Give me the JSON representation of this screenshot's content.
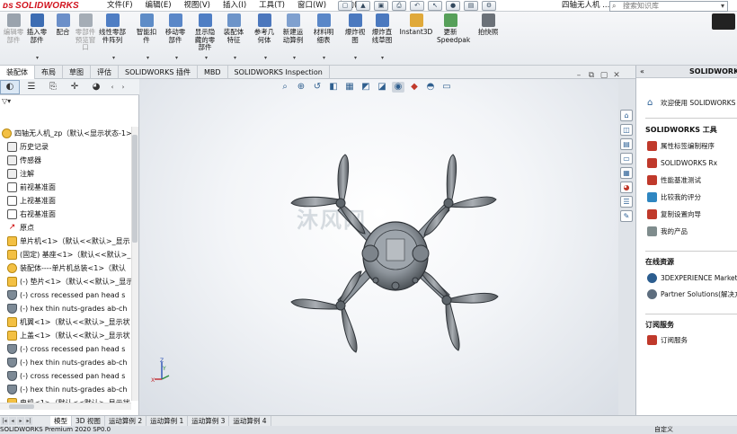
{
  "app": {
    "logo_text": "SOLIDWORKS",
    "doc_title": "四轴无人机 ...",
    "search_placeholder": "搜索知识库",
    "brand_color": "#d1121d"
  },
  "menu": [
    "文件(F)",
    "编辑(E)",
    "视图(V)",
    "插入(I)",
    "工具(T)",
    "窗口(W)",
    "帮助(H)"
  ],
  "ribbon": {
    "buttons": [
      {
        "label": "编辑零\n部件",
        "dim": true,
        "icon": "edit-component-icon"
      },
      {
        "label": "插入零\n部件",
        "dim": false,
        "icon": "insert-component-icon"
      },
      {
        "label": "配合",
        "dim": false,
        "icon": "mate-icon"
      },
      {
        "label": "零部件\n预览窗\n口",
        "dim": true,
        "icon": "preview-window-icon"
      },
      {
        "label": "线性零部\n件阵列",
        "dim": false,
        "icon": "linear-pattern-icon"
      },
      {
        "label": "智能扣\n件",
        "dim": false,
        "icon": "smart-fastener-icon"
      },
      {
        "label": "移动零\n部件",
        "dim": false,
        "icon": "move-component-icon"
      },
      {
        "label": "显示隐\n藏的零\n部件",
        "dim": false,
        "icon": "show-hidden-icon"
      },
      {
        "label": "装配体\n特征",
        "dim": false,
        "icon": "assembly-feature-icon"
      },
      {
        "label": "参考几\n何体",
        "dim": false,
        "icon": "reference-geometry-icon"
      },
      {
        "label": "新建运\n动算例",
        "dim": false,
        "icon": "motion-study-icon"
      },
      {
        "label": "材料明\n细表",
        "dim": false,
        "icon": "bom-icon"
      },
      {
        "label": "爆炸视\n图",
        "dim": false,
        "icon": "explode-view-icon"
      },
      {
        "label": "爆炸直\n线草图",
        "dim": false,
        "icon": "explode-line-sketch-icon"
      },
      {
        "label": "Instant3D",
        "dim": false,
        "icon": "instant3d-icon"
      },
      {
        "label": "更新\nSpeedpak",
        "dim": false,
        "icon": "speedpak-icon"
      },
      {
        "label": "拍快照",
        "dim": false,
        "icon": "snapshot-icon"
      }
    ]
  },
  "tabs": [
    "装配体",
    "布局",
    "草图",
    "评估",
    "SOLIDWORKS 插件",
    "MBD",
    "SOLIDWORKS Inspection"
  ],
  "active_tab": "装配体",
  "tree": {
    "root": "四轴无人机_zp（默认<显示状态-1>）",
    "items": [
      {
        "label": "历史记录",
        "icon": "folder"
      },
      {
        "label": "传感器",
        "icon": "folder"
      },
      {
        "label": "注解",
        "icon": "folder"
      },
      {
        "label": "前视基准面",
        "icon": "plane"
      },
      {
        "label": "上视基准面",
        "icon": "plane"
      },
      {
        "label": "右视基准面",
        "icon": "plane"
      },
      {
        "label": "原点",
        "icon": "origin"
      },
      {
        "label": "单片机<1>（默认<<默认>_显示",
        "icon": "part"
      },
      {
        "label": "(固定) 基座<1>（默认<<默认>_",
        "icon": "part"
      },
      {
        "label": "装配体----单片机总装<1>（默认",
        "icon": "asm"
      },
      {
        "label": "(-) 垫片<1>（默认<<默认>_显示",
        "icon": "part"
      },
      {
        "label": "(-) cross recessed pan head s",
        "icon": "screw"
      },
      {
        "label": "(-) hex thin nuts-grades ab-ch",
        "icon": "screw"
      },
      {
        "label": "机翼<1>（默认<<默认>_显示状",
        "icon": "part"
      },
      {
        "label": "上盖<1>（默认<<默认>_显示状",
        "icon": "part"
      },
      {
        "label": "(-) cross recessed pan head s",
        "icon": "screw"
      },
      {
        "label": "(-) hex thin nuts-grades ab-ch",
        "icon": "screw"
      },
      {
        "label": "(-) cross recessed pan head s",
        "icon": "screw"
      },
      {
        "label": "(-) hex thin nuts-grades ab-ch",
        "icon": "screw"
      },
      {
        "label": "电机<1>（默认<<默认>_显示状",
        "icon": "part"
      }
    ]
  },
  "viewport": {
    "watermark": "沐风网",
    "triad": {
      "x_label": "X",
      "y_label": "Y",
      "z_label": "Z"
    }
  },
  "taskpane": {
    "title": "SOLIDWORKS",
    "welcome": "欢迎使用 SOLIDWORKS",
    "tools_header": "SOLIDWORKS 工具",
    "tools": [
      "属性标签编制程序",
      "SOLIDWORKS Rx",
      "性能基准测试",
      "比较我的评分",
      "复制设置向导",
      "我的产品"
    ],
    "online_header": "在线资源",
    "online": [
      "3DEXPERIENCE Marketplace",
      "Partner Solutions(解决方案)"
    ],
    "subscription_header": "订阅服务",
    "subscription": [
      "订阅服务"
    ]
  },
  "bottom_tabs": [
    "模型",
    "3D 视图",
    "运动算例 2",
    "运动算例 1",
    "运动算例 3",
    "运动算例 4"
  ],
  "active_bottom_tab": "模型",
  "status": {
    "left": "SOLIDWORKS Premium 2020 SP0.0",
    "right": "自定义"
  }
}
